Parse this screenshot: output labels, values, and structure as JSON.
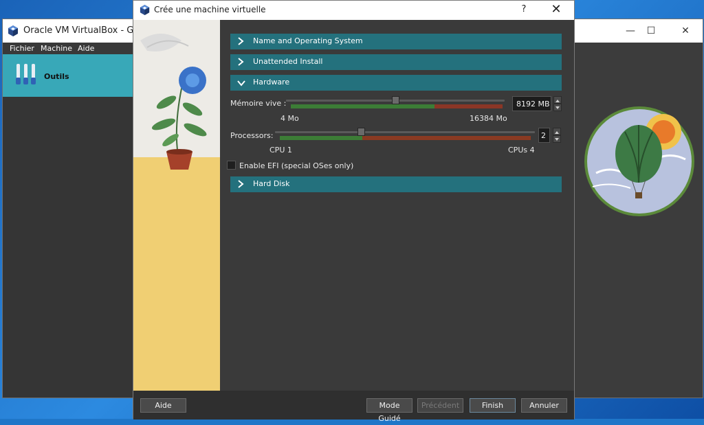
{
  "manager": {
    "title": "Oracle VM VirtualBox - Gesti",
    "menu": [
      "Fichier",
      "Machine",
      "Aide"
    ],
    "tools_label": "Outils",
    "controls": {
      "minimize": "—",
      "maximize": "☐",
      "close": "✕"
    }
  },
  "dialog": {
    "title": "Crée une machine virtuelle",
    "help_glyph": "?",
    "close_glyph": "✕",
    "sections": {
      "name_os": "Name and Operating System",
      "unattended": "Unattended Install",
      "hardware": "Hardware",
      "hard_disk": "Hard Disk"
    },
    "memory": {
      "label": "Mémoire vive :",
      "value": "8192 MB",
      "min_label": "4 Mo",
      "max_label": "16384 Mo",
      "level": 0.5
    },
    "processors": {
      "label": "Processors:",
      "value": "2",
      "min_label": "CPU 1",
      "max_label": "CPUs 4",
      "level": 0.33
    },
    "efi": {
      "label": "Enable EFI (special OSes only)",
      "checked": false
    },
    "buttons": {
      "aide": "Aide",
      "mode_guide": "Mode Guidé",
      "precedent": "Précédent",
      "finish": "Finish",
      "annuler": "Annuler"
    }
  },
  "colors": {
    "section_header": "#24717d",
    "tools_highlight": "#38a8b8",
    "scale_green": "#3c7d36",
    "scale_red": "#7d3b2a"
  }
}
